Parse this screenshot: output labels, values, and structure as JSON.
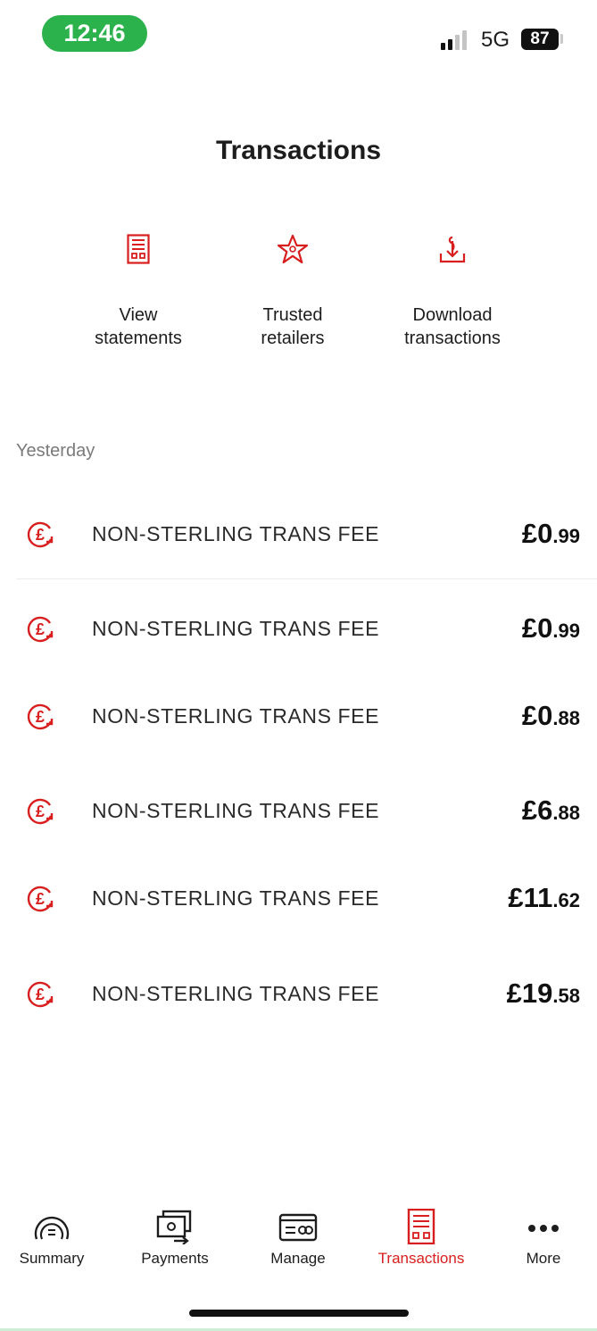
{
  "status_bar": {
    "time": "12:46",
    "network": "5G",
    "battery": "87"
  },
  "header": {
    "title": "Transactions"
  },
  "actions": [
    {
      "label": "View\nstatements",
      "icon": "statement-icon"
    },
    {
      "label": "Trusted\nretailers",
      "icon": "star-icon"
    },
    {
      "label": "Download\ntransactions",
      "icon": "download-icon"
    }
  ],
  "section": {
    "label": "Yesterday"
  },
  "transactions": [
    {
      "description": "NON-STERLING TRANS FEE",
      "amount_major": "£0",
      "amount_minor": ".99",
      "icon": "pound-fee-icon"
    },
    {
      "description": "NON-STERLING TRANS FEE",
      "amount_major": "£0",
      "amount_minor": ".99",
      "icon": "pound-fee-icon"
    },
    {
      "description": "NON-STERLING TRANS FEE",
      "amount_major": "£0",
      "amount_minor": ".88",
      "icon": "pound-fee-icon"
    },
    {
      "description": "NON-STERLING TRANS FEE",
      "amount_major": "£6",
      "amount_minor": ".88",
      "icon": "pound-fee-icon"
    },
    {
      "description": "NON-STERLING TRANS FEE",
      "amount_major": "£11",
      "amount_minor": ".62",
      "icon": "pound-fee-icon"
    },
    {
      "description": "NON-STERLING TRANS FEE",
      "amount_major": "£19",
      "amount_minor": ".58",
      "icon": "pound-fee-icon"
    }
  ],
  "nav": {
    "items": [
      {
        "label": "Summary",
        "icon": "summary-icon",
        "active": false
      },
      {
        "label": "Payments",
        "icon": "payments-icon",
        "active": false
      },
      {
        "label": "Manage",
        "icon": "manage-icon",
        "active": false
      },
      {
        "label": "Transactions",
        "icon": "transactions-icon",
        "active": true
      },
      {
        "label": "More",
        "icon": "more-icon",
        "active": false
      }
    ]
  },
  "colors": {
    "accent": "#d81e1e",
    "time_pill": "#2bb24c",
    "text": "#1d1d1d",
    "muted": "#7a7a7a"
  }
}
